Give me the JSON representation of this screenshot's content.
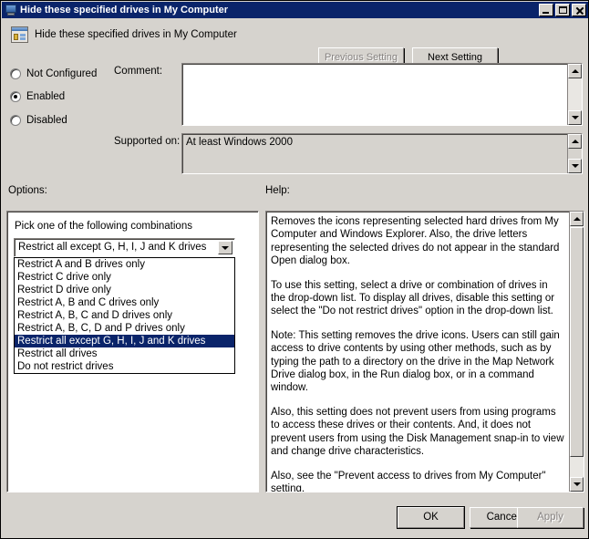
{
  "window": {
    "title": "Hide these specified drives in My Computer",
    "title_icon": "computer-monitor-icon",
    "controls": {
      "minimize": "minimize-icon",
      "maximize": "maximize-icon",
      "close": "close-icon"
    }
  },
  "header": {
    "icon": "policy-setting-icon",
    "title": "Hide these specified drives in My Computer",
    "previous_setting_label": "Previous Setting",
    "next_setting_label": "Next Setting",
    "previous_enabled": false,
    "next_enabled": true
  },
  "state": {
    "options": [
      {
        "label": "Not Configured",
        "selected": false
      },
      {
        "label": "Enabled",
        "selected": true
      },
      {
        "label": "Disabled",
        "selected": false
      }
    ]
  },
  "comment": {
    "label": "Comment:",
    "value": "",
    "placeholder": ""
  },
  "supported_on": {
    "label": "Supported on:",
    "value": "At least Windows 2000"
  },
  "sections": {
    "options_label": "Options:",
    "help_label": "Help:"
  },
  "options_panel": {
    "caption": "Pick one of the following combinations",
    "combo": {
      "value": "Restrict all except G, H, I, J and K drives",
      "expanded": true,
      "arrow_icon": "chevron-down-icon",
      "items": [
        "Restrict A and B drives only",
        "Restrict C drive only",
        "Restrict D drive only",
        "Restrict A, B and C drives only",
        "Restrict A, B, C and D drives only",
        "Restrict A, B, C, D and P drives only",
        "Restrict all except G, H, I, J and K drives",
        "Restrict all drives",
        "Do not restrict drives"
      ],
      "selected_index": 6
    }
  },
  "help_panel": {
    "paragraphs": [
      "Removes the icons representing selected hard drives from My Computer and Windows Explorer. Also, the drive letters representing the selected drives do not appear in the standard Open dialog box.",
      "To use this setting, select a drive or combination of drives in the drop-down list. To display all drives, disable this setting or select the \"Do not restrict drives\" option in the drop-down list.",
      "Note: This setting removes the drive icons. Users can still gain access to drive contents by using other methods, such as by typing the path to a directory on the drive in the Map Network Drive dialog box, in the Run dialog box, or in a command window.",
      "Also, this setting does not prevent users from using programs to access these drives or their contents. And, it does not prevent users from using the Disk Management snap-in to view and change drive characteristics.",
      "Also, see the \"Prevent access to drives from My Computer\" setting."
    ]
  },
  "footer": {
    "ok_label": "OK",
    "cancel_label": "Cancel",
    "apply_label": "Apply",
    "apply_enabled": false,
    "default_button": "OK"
  },
  "colors": {
    "titlebar": "#0a246a",
    "dialog_background": "#d6d3ce",
    "selection": "#0a246a",
    "selection_text": "#ffffff",
    "field_background": "#ffffff",
    "disabled_text": "#868280"
  }
}
